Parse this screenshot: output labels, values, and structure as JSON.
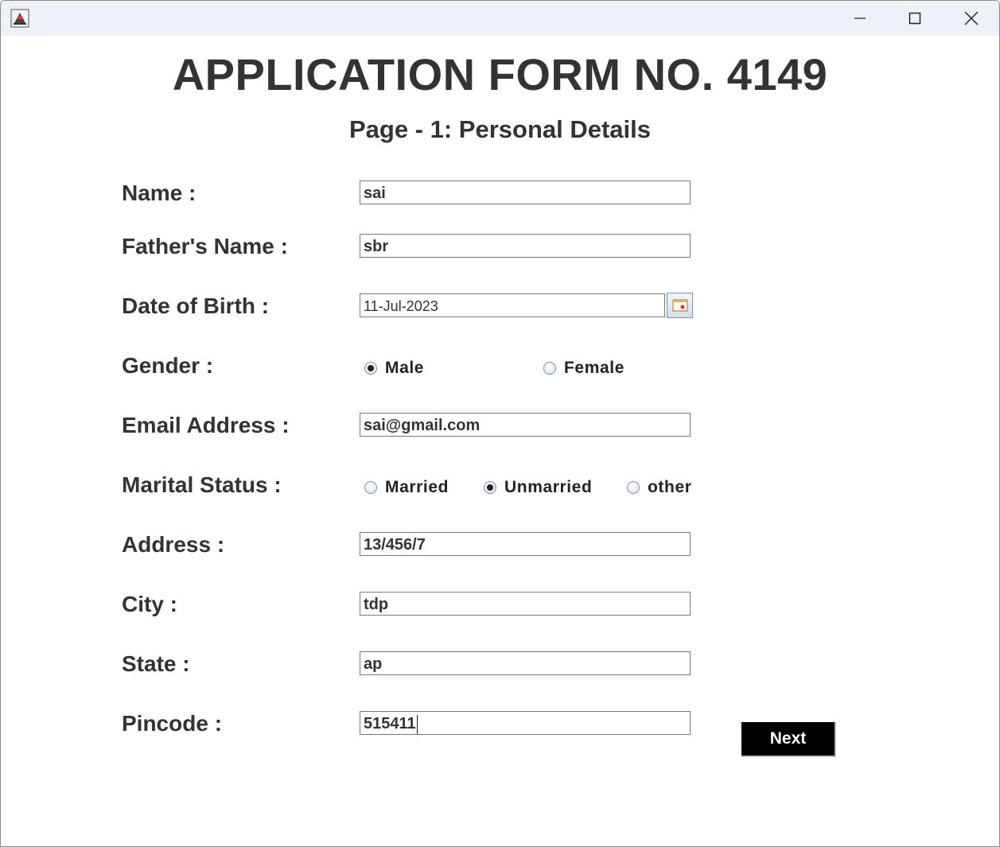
{
  "window": {
    "minimize_icon": "minimize-icon",
    "maximize_icon": "maximize-icon",
    "close_icon": "close-icon",
    "app_icon": "java-app-icon"
  },
  "form": {
    "title": "APPLICATION FORM NO. 4149",
    "subtitle": "Page - 1: Personal Details"
  },
  "fields": {
    "name": {
      "label": "Name :",
      "value": "sai"
    },
    "father_name": {
      "label": "Father's Name :",
      "value": "sbr"
    },
    "dob": {
      "label": "Date of Birth :",
      "value": "11-Jul-2023",
      "picker_icon": "calendar-icon"
    },
    "gender": {
      "label": "Gender :",
      "options": [
        "Male",
        "Female"
      ],
      "selected": "Male"
    },
    "email": {
      "label": "Email Address :",
      "value": "sai@gmail.com"
    },
    "marital_status": {
      "label": "Marital Status :",
      "options": [
        "Married",
        "Unmarried",
        "other"
      ],
      "selected": "Unmarried"
    },
    "address": {
      "label": "Address :",
      "value": "13/456/7"
    },
    "city": {
      "label": "City :",
      "value": "tdp"
    },
    "state": {
      "label": "State :",
      "value": "ap"
    },
    "pincode": {
      "label": "Pincode :",
      "value": "515411"
    }
  },
  "actions": {
    "next_label": "Next"
  },
  "colors": {
    "titlebar": "#eef1f8",
    "text": "#333333",
    "button_bg": "#000000",
    "button_text": "#ffffff"
  }
}
